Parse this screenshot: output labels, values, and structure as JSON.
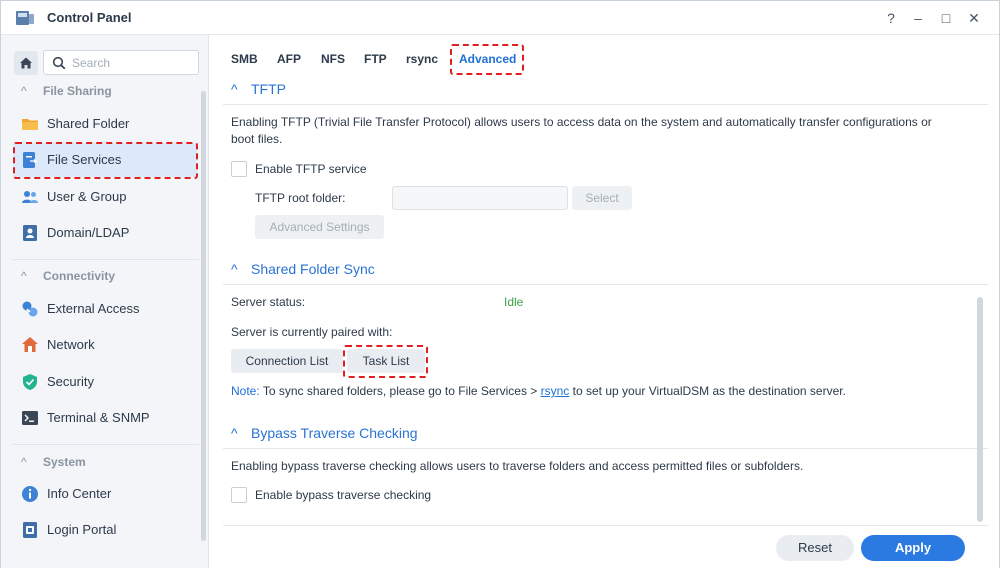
{
  "window": {
    "title": "Control Panel",
    "help": "?",
    "minimize": "–",
    "maximize": "□",
    "close": "✕"
  },
  "sidebar": {
    "search_placeholder": "Search",
    "groups": [
      {
        "title": "File Sharing",
        "items": [
          {
            "label": "Shared Folder",
            "icon": "folder-icon"
          },
          {
            "label": "File Services",
            "icon": "file-services-icon",
            "active": true
          }
        ]
      },
      {
        "title": "",
        "items": [
          {
            "label": "User & Group",
            "icon": "users-icon"
          },
          {
            "label": "Domain/LDAP",
            "icon": "domain-icon"
          }
        ]
      },
      {
        "title": "Connectivity",
        "items": [
          {
            "label": "External Access",
            "icon": "external-access-icon"
          },
          {
            "label": "Network",
            "icon": "network-icon"
          },
          {
            "label": "Security",
            "icon": "shield-icon"
          },
          {
            "label": "Terminal & SNMP",
            "icon": "terminal-icon"
          }
        ]
      },
      {
        "title": "System",
        "items": [
          {
            "label": "Info Center",
            "icon": "info-icon"
          },
          {
            "label": "Login Portal",
            "icon": "login-portal-icon"
          }
        ]
      }
    ]
  },
  "tabs": [
    "SMB",
    "AFP",
    "NFS",
    "FTP",
    "rsync",
    "Advanced"
  ],
  "active_tab": "Advanced",
  "tftp": {
    "header": "TFTP",
    "description_1": "Enabling TFTP (Trivial File Transfer Protocol) allows users to access data on the system and automatically transfer configurations or",
    "description_2": "boot files.",
    "enable_label": "Enable TFTP service",
    "enabled": false,
    "root_folder_label": "TFTP root folder:",
    "root_folder_value": "",
    "select_button": "Select",
    "advanced_button": "Advanced Settings"
  },
  "shared_folder_sync": {
    "header": "Shared Folder Sync",
    "server_status_label": "Server status:",
    "server_status_value": "Idle",
    "paired_label": "Server is currently paired with:",
    "connection_list_button": "Connection List",
    "task_list_button": "Task List",
    "note_label": "Note:",
    "note_before": "To sync shared folders, please go to File Services >",
    "note_link": "rsync",
    "note_after": "to set up your VirtualDSM as the destination server."
  },
  "bypass": {
    "header": "Bypass Traverse Checking",
    "description": "Enabling bypass traverse checking allows users to traverse folders and access permitted files or subfolders.",
    "enable_label": "Enable bypass traverse checking",
    "enabled": false
  },
  "footer": {
    "reset": "Reset",
    "apply": "Apply"
  },
  "colors": {
    "accent": "#2a7ae2",
    "highlight": "#e02020",
    "status_idle": "#3aa34a"
  }
}
